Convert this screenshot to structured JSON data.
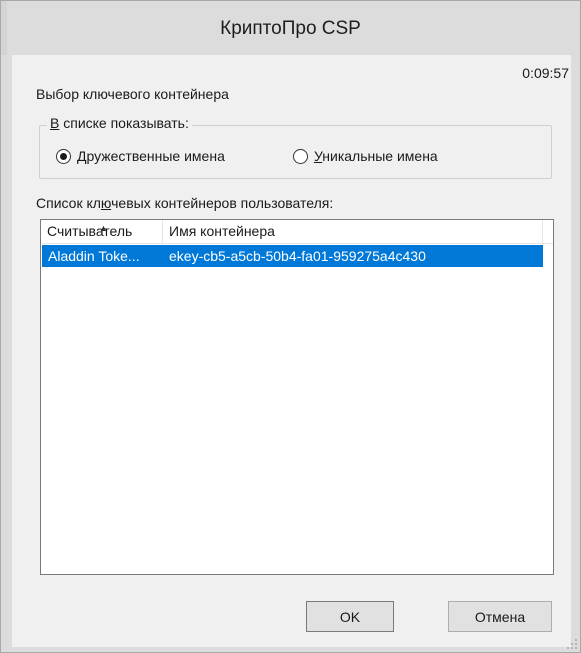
{
  "window": {
    "title": "КриптоПро CSP"
  },
  "dialog": {
    "timer": "0:09:57",
    "heading": "Выбор ключевого контейнера",
    "show_group": {
      "legend_mnemonic": "В",
      "legend_rest": " списке показывать:",
      "options": [
        {
          "mnemonic": "Д",
          "rest": "ружественные имена",
          "selected": true
        },
        {
          "mnemonic": "У",
          "rest": "никальные имена",
          "selected": false
        }
      ]
    },
    "list_label": {
      "before": "Список кл",
      "mnemonic": "ю",
      "after": "чевых контейнеров пользователя:"
    },
    "columns": [
      "Считыватель",
      "Имя контейнера"
    ],
    "rows": [
      {
        "reader": "Aladdin Toke...",
        "container": "ekey-cb5-a5cb-50b4-fa01-959275a4c430",
        "selected": true
      }
    ],
    "buttons": {
      "ok": "OK",
      "cancel": "Отмена"
    }
  },
  "colors": {
    "selection": "#0078d7",
    "window_bg": "#f0f0f0",
    "titlebar": "#dcdcdc"
  },
  "icons": {
    "sort": "sort-ascending-icon",
    "grip": "size-grip-icon"
  }
}
